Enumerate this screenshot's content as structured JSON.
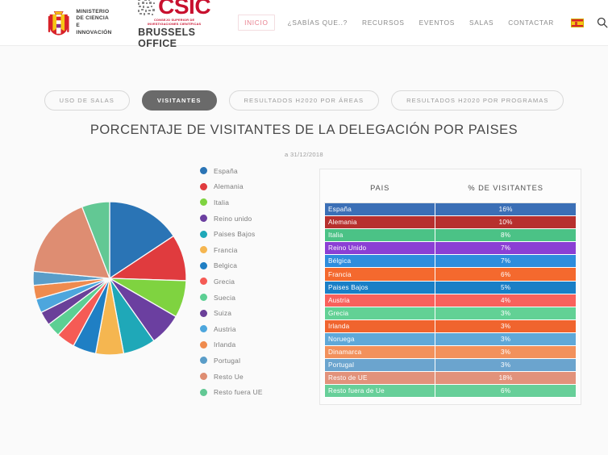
{
  "header": {
    "ministerio": [
      "MINISTERIO",
      "DE CIENCIA",
      "E INNOVACIÓN"
    ],
    "coat_icon": "spain-coat-of-arms-icon",
    "csic_word": "CSIC",
    "csic_sub": "CONSEJO SUPERIOR DE INVESTIGACIONES CIENTÍFICAS",
    "csic_office": "BRUSSELS OFFICE",
    "nav": [
      {
        "label": "INICIO",
        "active": true
      },
      {
        "label": "¿SABÍAS QUE..?",
        "active": false
      },
      {
        "label": "RECURSOS",
        "active": false
      },
      {
        "label": "EVENTOS",
        "active": false
      },
      {
        "label": "SALAS",
        "active": false
      },
      {
        "label": "CONTACTAR",
        "active": false
      }
    ],
    "flag_icon": "spain-flag-icon",
    "search_icon": "search-icon",
    "active_nav_color": "#e8808f"
  },
  "tabs": [
    {
      "label": "USO DE SALAS",
      "active": false
    },
    {
      "label": "VISITANTES",
      "active": true
    },
    {
      "label": "RESULTADOS H2020 POR ÁREAS",
      "active": false
    },
    {
      "label": "RESULTADOS H2020 POR PROGRAMAS",
      "active": false
    }
  ],
  "title": "PORCENTAJE DE VISITANTES DE LA DELEGACIÓN POR PAISES",
  "subtitle": "a 31/12/2018",
  "table": {
    "headers": [
      "PAIS",
      "% DE VISITANTES"
    ],
    "rows": [
      {
        "country": "España",
        "pct": "16%",
        "color": "#3b6fb6"
      },
      {
        "country": "Alemania",
        "pct": "10%",
        "color": "#b7302e"
      },
      {
        "country": "Italia",
        "pct": "8%",
        "color": "#4bc286"
      },
      {
        "country": "Reino Unido",
        "pct": "7%",
        "color": "#8b3fd4"
      },
      {
        "country": "Bélgica",
        "pct": "7%",
        "color": "#2e8ddd"
      },
      {
        "country": "Francia",
        "pct": "6%",
        "color": "#f4692e"
      },
      {
        "country": "Paises Bajos",
        "pct": "5%",
        "color": "#1a7fc6"
      },
      {
        "country": "Austria",
        "pct": "4%",
        "color": "#f9615c"
      },
      {
        "country": "Grecia",
        "pct": "3%",
        "color": "#62d195"
      },
      {
        "country": "Irlanda",
        "pct": "3%",
        "color": "#f0642e"
      },
      {
        "country": "Noruega",
        "pct": "3%",
        "color": "#5fa8d8"
      },
      {
        "country": "Dinamarca",
        "pct": "3%",
        "color": "#f2915c"
      },
      {
        "country": "Portugal",
        "pct": "3%",
        "color": "#6ba4ce"
      },
      {
        "country": "Resto de UE",
        "pct": "18%",
        "color": "#e2927b"
      },
      {
        "country": "Resto fuera de Ue",
        "pct": "6%",
        "color": "#67cf99"
      }
    ]
  },
  "legend": [
    {
      "label": "España",
      "color": "#2a74b5"
    },
    {
      "label": "Alemania",
      "color": "#e03b3e"
    },
    {
      "label": "Italia",
      "color": "#7fd340"
    },
    {
      "label": "Reino unido",
      "color": "#6b3fa0"
    },
    {
      "label": "Paises Bajos",
      "color": "#1fa8b8"
    },
    {
      "label": "Francia",
      "color": "#f5b650"
    },
    {
      "label": "Belgica",
      "color": "#1f7fc4"
    },
    {
      "label": "Grecia",
      "color": "#f55b55"
    },
    {
      "label": "Suecia",
      "color": "#5ccf93"
    },
    {
      "label": "Suiza",
      "color": "#6a4099"
    },
    {
      "label": "Austria",
      "color": "#4da6dd"
    },
    {
      "label": "Irlanda",
      "color": "#ef8b4e"
    },
    {
      "label": "Portugal",
      "color": "#5a9dc8"
    },
    {
      "label": "Resto Ue",
      "color": "#de8d72"
    },
    {
      "label": "Resto fuera UE",
      "color": "#62c894"
    }
  ],
  "chart_data": {
    "type": "pie",
    "title": "PORCENTAJE DE VISITANTES DE LA DELEGACIÓN POR PAISES",
    "subtitle": "a 31/12/2018",
    "legend_position": "right",
    "unit": "%",
    "labels": [
      "España",
      "Alemania",
      "Italia",
      "Reino unido",
      "Paises Bajos",
      "Francia",
      "Belgica",
      "Grecia",
      "Suecia",
      "Suiza",
      "Austria",
      "Irlanda",
      "Portugal",
      "Resto Ue",
      "Resto fuera UE"
    ],
    "values": [
      16,
      10,
      8,
      7,
      7,
      6,
      5,
      4,
      3,
      3,
      3,
      3,
      3,
      18,
      6
    ],
    "colors": [
      "#2a74b5",
      "#e03b3e",
      "#7fd340",
      "#6b3fa0",
      "#1fa8b8",
      "#f5b650",
      "#1f7fc4",
      "#f55b55",
      "#5ccf93",
      "#6a4099",
      "#4da6dd",
      "#ef8b4e",
      "#5a9dc8",
      "#de8d72",
      "#62c894"
    ],
    "start_angle_deg": 0,
    "direction": "clockwise"
  }
}
